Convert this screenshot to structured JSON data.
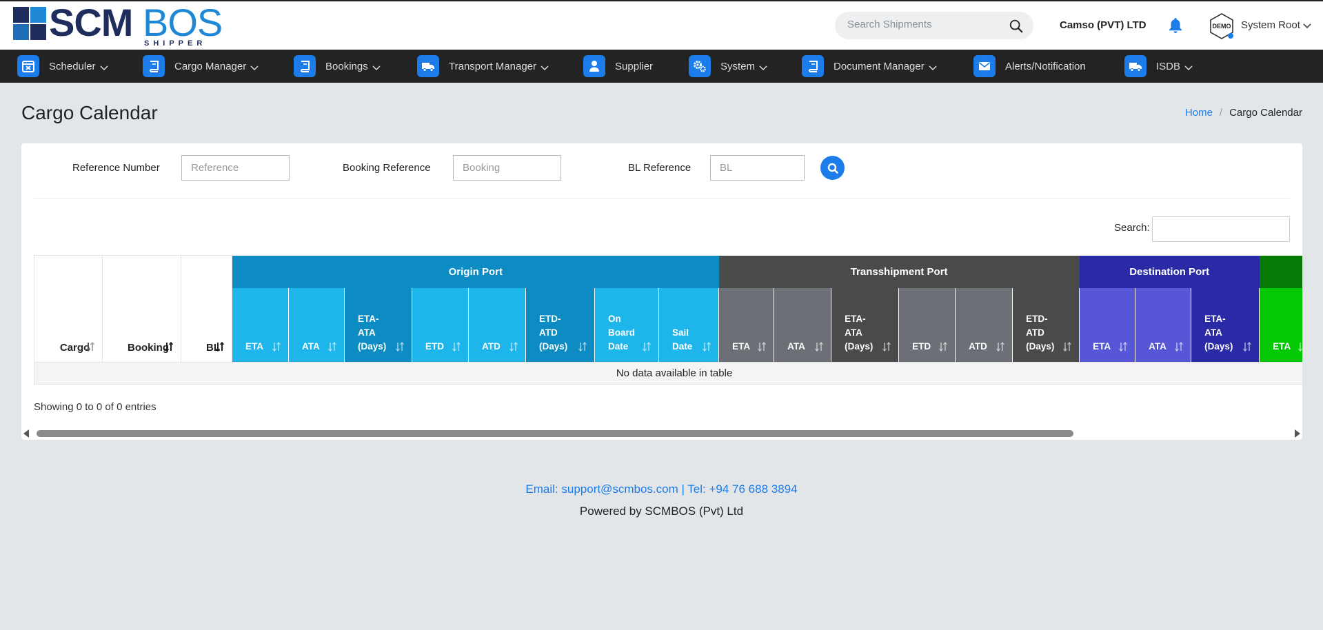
{
  "brand": {
    "logo_main": "SCM",
    "logo_accent": "BOS",
    "logo_sub": "SHIPPER"
  },
  "header": {
    "search_placeholder": "Search Shipments",
    "company": "Camso (PVT) LTD",
    "avatar_text": "DEMO",
    "user_name": "System Root"
  },
  "nav": {
    "items": [
      {
        "label": "Scheduler",
        "icon": "calendar-x-icon"
      },
      {
        "label": "Cargo Manager",
        "icon": "book-icon"
      },
      {
        "label": "Bookings",
        "icon": "book-icon"
      },
      {
        "label": "Transport Manager",
        "icon": "truck-icon"
      },
      {
        "label": "Supplier",
        "icon": "person-icon"
      },
      {
        "label": "System",
        "icon": "gears-icon"
      },
      {
        "label": "Document Manager",
        "icon": "book-icon"
      },
      {
        "label": "Alerts/Notification",
        "icon": "envelope-icon"
      },
      {
        "label": "ISDB",
        "icon": "truck-icon"
      }
    ]
  },
  "page": {
    "title": "Cargo Calendar",
    "breadcrumb_home": "Home",
    "breadcrumb_sep": "/",
    "breadcrumb_current": "Cargo Calendar"
  },
  "filters": {
    "reference_label": "Reference Number",
    "reference_placeholder": "Reference",
    "booking_label": "Booking Reference",
    "booking_placeholder": "Booking",
    "bl_label": "BL Reference",
    "bl_placeholder": "BL"
  },
  "table": {
    "search_label": "Search:",
    "fixed_cols": [
      "Cargo",
      "Booking",
      "BL"
    ],
    "groups": [
      {
        "label": "Origin Port",
        "color": "#0c8cc2"
      },
      {
        "label": "Transshipment Port",
        "color": "#4a4a4a"
      },
      {
        "label": "Destination Port",
        "color": "#2a2aa6"
      },
      {
        "label": "",
        "color": "#057a05"
      }
    ],
    "sub_origin": [
      "ETA",
      "ATA",
      "ETA-\nATA\n(Days)",
      "ETD",
      "ATD",
      "ETD-\nATD\n(Days)",
      "On\nBoard\nDate",
      "Sail\nDate"
    ],
    "sub_trans": [
      "ETA",
      "ATA",
      "ETA-\nATA\n(Days)",
      "ETD",
      "ATD",
      "ETD-\nATD\n(Days)"
    ],
    "sub_dest": [
      "ETA",
      "ATA",
      "ETA-\nATA\n(Days)"
    ],
    "sub_last": [
      "ETA"
    ],
    "empty_message": "No data available in table",
    "info": "Showing 0 to 0 of 0 entries"
  },
  "footer": {
    "contact": "Email: support@scmbos.com | Tel: +94 76 688 3894",
    "powered": "Powered by SCMBOS (Pvt) Ltd"
  }
}
